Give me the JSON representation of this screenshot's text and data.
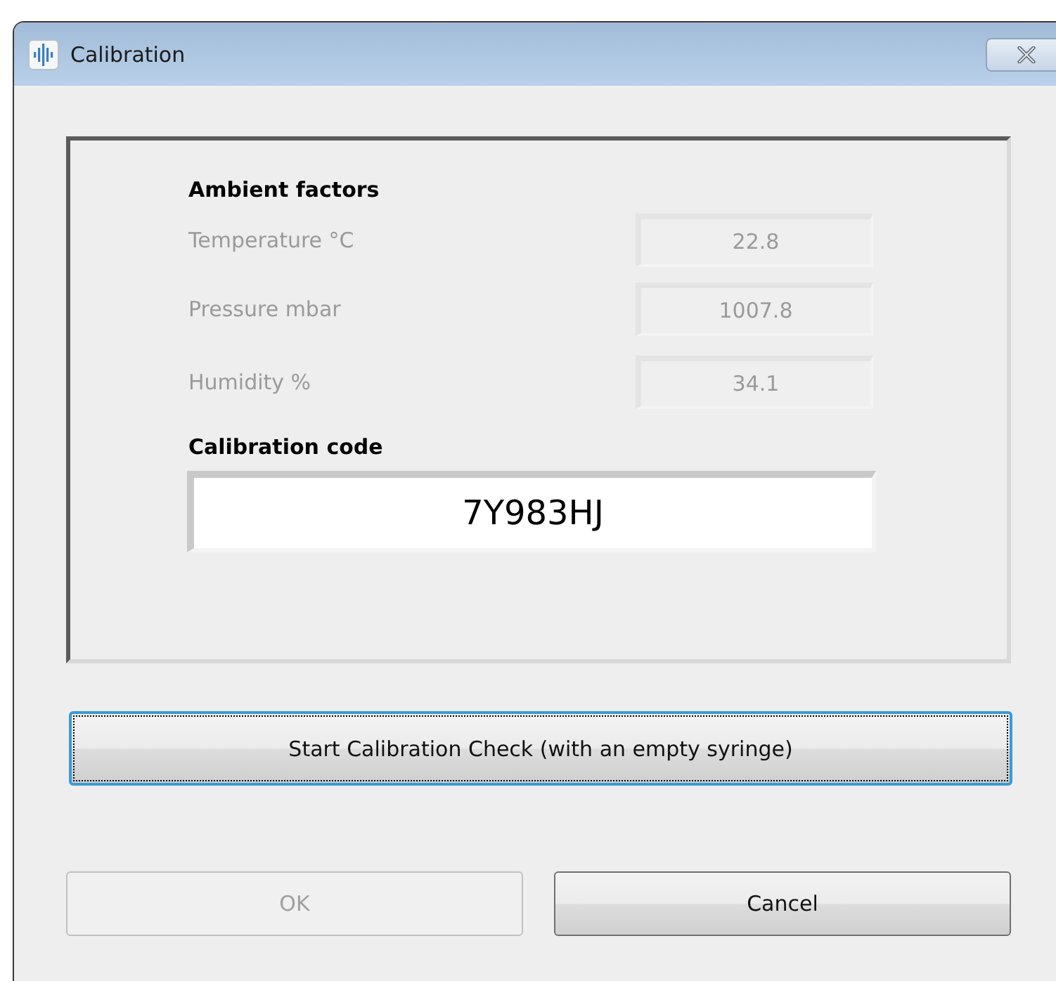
{
  "window": {
    "title": "Calibration"
  },
  "ambient": {
    "heading": "Ambient factors",
    "fields": [
      {
        "label": "Temperature °C",
        "value": "22.8",
        "disabled": true
      },
      {
        "label": "Pressure mbar",
        "value": "1007.8",
        "disabled": true
      },
      {
        "label": "Humidity %",
        "value": "34.1",
        "disabled": true
      }
    ]
  },
  "calibration": {
    "heading": "Calibration code",
    "value": "7Y983HJ"
  },
  "start_button": {
    "label": "Start Calibration Check (with an empty syringe)",
    "focused": true
  },
  "buttons": [
    {
      "label": "OK",
      "disabled": true
    },
    {
      "label": "Cancel",
      "disabled": false
    }
  ]
}
